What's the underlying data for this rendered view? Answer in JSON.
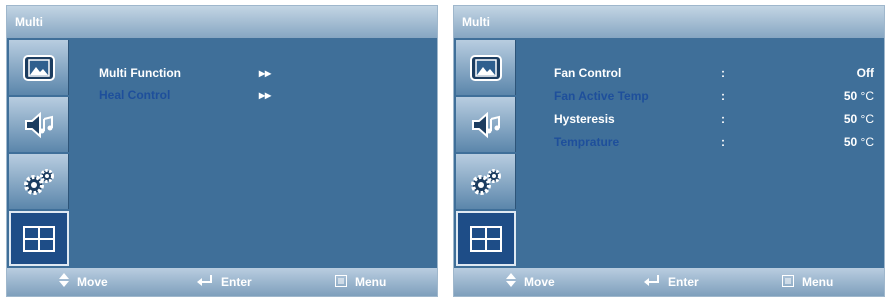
{
  "colors": {
    "panel_bg": "#3f6f99",
    "highlight_text": "#1e4f9b",
    "active_side_item": "#1e4d87"
  },
  "left_panel": {
    "title": "Multi",
    "sidebar": [
      {
        "icon": "picture-icon",
        "active": false
      },
      {
        "icon": "sound-icon",
        "active": false
      },
      {
        "icon": "settings-gears-icon",
        "active": false
      },
      {
        "icon": "multi-window-icon",
        "active": true
      }
    ],
    "menu": [
      {
        "label": "Multi Function",
        "arrow": "▸▸",
        "highlighted": false
      },
      {
        "label": "Heal Control",
        "arrow": "▸▸",
        "highlighted": true
      }
    ],
    "footer": {
      "move_icon": "updown-arrows-icon",
      "move": "Move",
      "enter_icon": "enter-arrow-icon",
      "enter": "Enter",
      "menu_icon": "menu-icon",
      "menu": "Menu"
    }
  },
  "right_panel": {
    "title": "Multi",
    "sidebar": [
      {
        "icon": "picture-icon",
        "active": false
      },
      {
        "icon": "sound-icon",
        "active": false
      },
      {
        "icon": "settings-gears-icon",
        "active": false
      },
      {
        "icon": "multi-window-icon",
        "active": true
      }
    ],
    "settings": [
      {
        "label": "Fan Control",
        "colon": ":",
        "value": "Off",
        "unit": "",
        "highlighted": false
      },
      {
        "label": "Fan Active Temp",
        "colon": ":",
        "value": "50",
        "unit": " °C",
        "highlighted": true
      },
      {
        "label": "Hysteresis",
        "colon": ":",
        "value": "50",
        "unit": " °C",
        "highlighted": false
      },
      {
        "label": "Temprature",
        "colon": ":",
        "value": "50",
        "unit": " °C",
        "highlighted": true
      }
    ],
    "footer": {
      "move_icon": "updown-arrows-icon",
      "move": "Move",
      "enter_icon": "enter-arrow-icon",
      "enter": "Enter",
      "menu_icon": "menu-icon",
      "menu": "Menu"
    }
  }
}
